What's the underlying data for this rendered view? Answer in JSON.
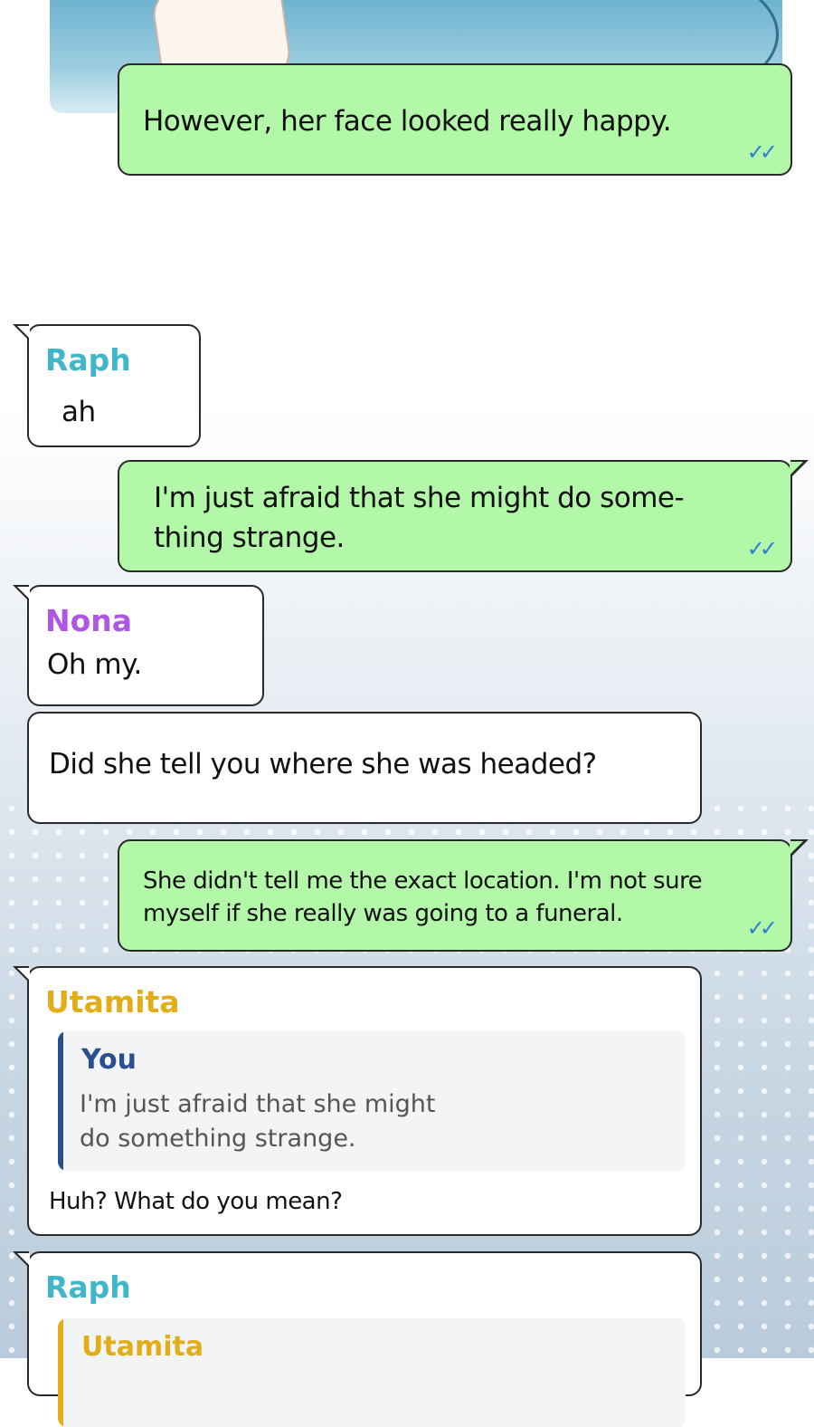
{
  "colors": {
    "outgoing_bubble": "#b3f7a9",
    "incoming_bubble": "#ffffff",
    "raph": "#3fb6c9",
    "nona": "#b056e6",
    "utamita": "#e2ad17",
    "you": "#2a4f8f",
    "read_check": "#2a7fd4"
  },
  "icons": {
    "read_receipt": "double-check-icon"
  },
  "messages": [
    {
      "id": "m1",
      "direction": "outgoing",
      "text": "However, her face looked really happy.",
      "read": "✓✓"
    },
    {
      "id": "m2",
      "direction": "incoming",
      "sender": "Raph",
      "text": "ah"
    },
    {
      "id": "m3",
      "direction": "outgoing",
      "line1": "I'm just afraid that she might do some-",
      "line2": "thing strange.",
      "read": "✓✓"
    },
    {
      "id": "m4",
      "direction": "incoming",
      "sender": "Nona",
      "text": "Oh my."
    },
    {
      "id": "m5",
      "direction": "incoming",
      "text": "Did she tell you where she was headed?"
    },
    {
      "id": "m6",
      "direction": "outgoing",
      "line1": "She didn't tell me the exact location. I'm not sure",
      "line2": "myself if she really was going to a funeral.",
      "read": "✓✓"
    },
    {
      "id": "m7",
      "direction": "incoming",
      "sender": "Utamita",
      "quote": {
        "name": "You",
        "line1": "I'm just afraid that she might",
        "line2": "do something strange."
      },
      "text": "Huh? What do you mean?"
    },
    {
      "id": "m8",
      "direction": "incoming",
      "sender": "Raph",
      "quote": {
        "name": "Utamita"
      }
    }
  ]
}
